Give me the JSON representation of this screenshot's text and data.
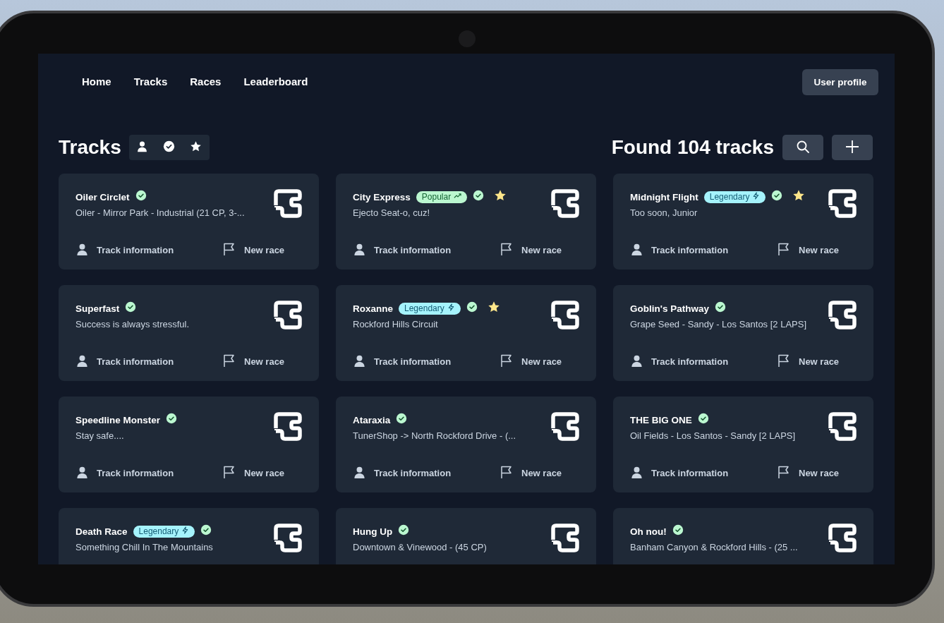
{
  "nav": {
    "links": [
      "Home",
      "Tracks",
      "Races",
      "Leaderboard"
    ],
    "profile_button": "User profile"
  },
  "header": {
    "title": "Tracks",
    "count": "Found 104 tracks"
  },
  "tracks": [
    {
      "name": "Oiler Circlet",
      "verified": true,
      "starred": false,
      "description": "Oiler - Mirror Park - Industrial (21 CP, 3-...",
      "info_button": "Track information",
      "race_button": "New race"
    },
    {
      "name": "City Express",
      "badge": {
        "kind": "popular",
        "label": "Popular"
      },
      "verified": true,
      "starred": true,
      "description": "Ejecto Seat-o, cuz!",
      "info_button": "Track information",
      "race_button": "New race"
    },
    {
      "name": "Midnight Flight",
      "badge": {
        "kind": "legendary",
        "label": "Legendary"
      },
      "verified": true,
      "starred": true,
      "description": "Too soon, Junior",
      "info_button": "Track information",
      "race_button": "New race"
    },
    {
      "name": "Superfast",
      "verified": true,
      "starred": false,
      "description": "Success is always stressful.",
      "info_button": "Track information",
      "race_button": "New race"
    },
    {
      "name": "Roxanne",
      "badge": {
        "kind": "legendary",
        "label": "Legendary"
      },
      "verified": true,
      "starred": true,
      "description": "Rockford Hills Circuit",
      "info_button": "Track information",
      "race_button": "New race"
    },
    {
      "name": "Goblin's Pathway",
      "verified": true,
      "starred": false,
      "description": "Grape Seed - Sandy - Los Santos [2 LAPS]",
      "info_button": "Track information",
      "race_button": "New race"
    },
    {
      "name": "Speedline Monster",
      "verified": true,
      "starred": false,
      "description": "Stay safe....",
      "info_button": "Track information",
      "race_button": "New race"
    },
    {
      "name": "Ataraxia",
      "verified": true,
      "starred": false,
      "description": "TunerShop -> North Rockford Drive - (...",
      "info_button": "Track information",
      "race_button": "New race"
    },
    {
      "name": "THE BIG ONE",
      "verified": true,
      "starred": false,
      "description": "Oil Fields - Los Santos - Sandy [2 LAPS]",
      "info_button": "Track information",
      "race_button": "New race"
    },
    {
      "name": "Death Race",
      "badge": {
        "kind": "legendary",
        "label": "Legendary"
      },
      "verified": true,
      "starred": false,
      "description": "Something Chill In The Mountains"
    },
    {
      "name": "Hung Up",
      "verified": true,
      "starred": false,
      "description": "Downtown & Vinewood - (45 CP)"
    },
    {
      "name": "Oh nou!",
      "verified": true,
      "starred": false,
      "description": "Banham Canyon & Rockford Hills - (25 ..."
    }
  ]
}
